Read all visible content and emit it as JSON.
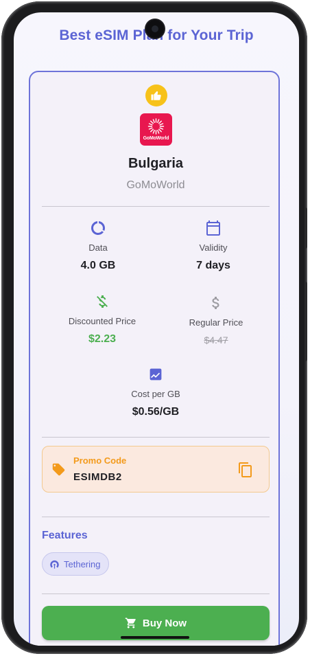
{
  "page": {
    "title": "Best eSIM Plan for Your Trip"
  },
  "plan": {
    "country": "Bulgaria",
    "provider": "GoMoWorld",
    "logo_text": "GoMoWorld",
    "badge_icon": "thumbs-up-icon"
  },
  "stats": {
    "data": {
      "label": "Data",
      "value": "4.0 GB",
      "icon": "donut-chart-icon"
    },
    "validity": {
      "label": "Validity",
      "value": "7 days",
      "icon": "calendar-icon"
    },
    "discounted": {
      "label": "Discounted Price",
      "value": "$2.23",
      "icon": "dollar-off-icon"
    },
    "regular": {
      "label": "Regular Price",
      "value": "$4.47",
      "icon": "dollar-icon"
    },
    "cost_per_gb": {
      "label": "Cost per GB",
      "value": "$0.56/GB",
      "icon": "trend-chart-icon"
    }
  },
  "promo": {
    "label": "Promo Code",
    "code": "ESIMDB2",
    "tag_icon": "tag-icon",
    "copy_icon": "copy-icon"
  },
  "features": {
    "title": "Features",
    "items": [
      {
        "label": "Tethering",
        "icon": "hotspot-icon"
      }
    ]
  },
  "actions": {
    "buy_label": "Buy Now",
    "buy_icon": "cart-icon"
  },
  "colors": {
    "accent": "#5b64d4",
    "price_green": "#4caf50",
    "promo_orange": "#f39a1b",
    "badge_yellow": "#f7c21a",
    "logo_red": "#e8174f"
  }
}
